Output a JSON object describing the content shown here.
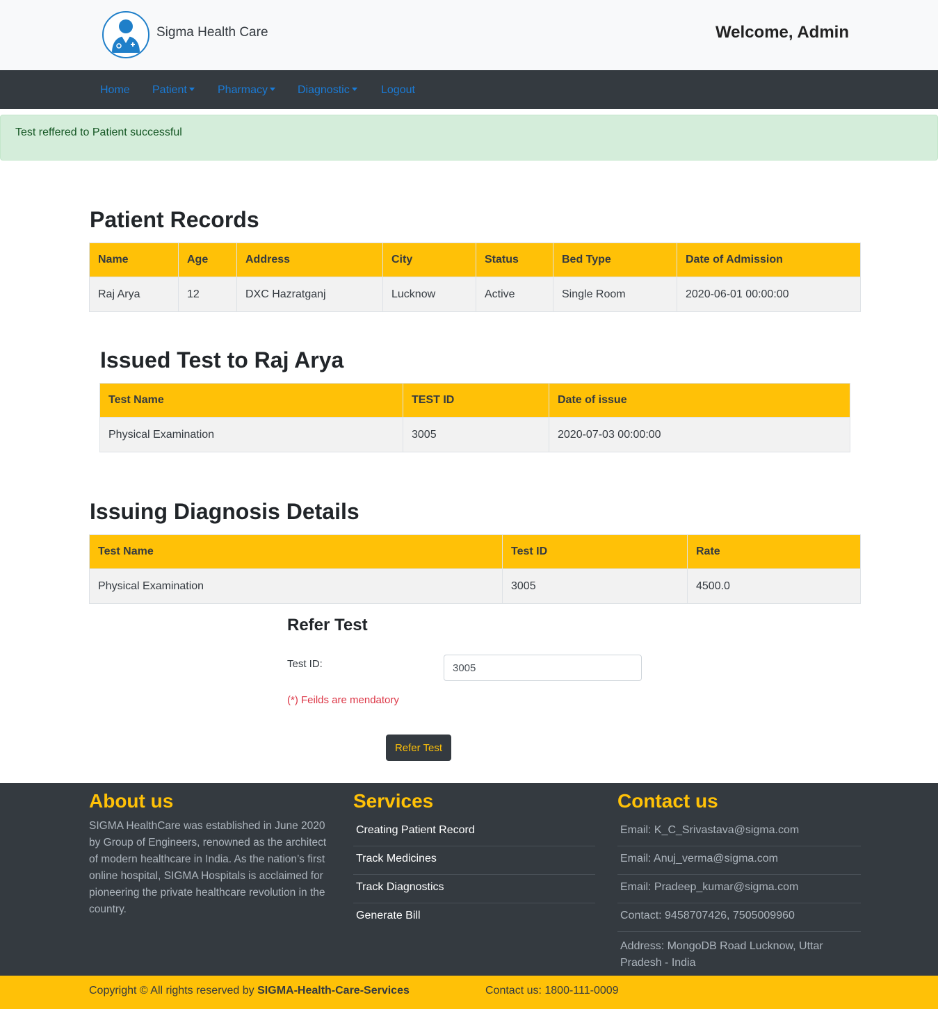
{
  "header": {
    "brand": "Sigma Health Care",
    "welcome": "Welcome, Admin"
  },
  "nav": {
    "home": "Home",
    "patient": "Patient",
    "pharmacy": "Pharmacy",
    "diagnostic": "Diagnostic",
    "logout": "Logout"
  },
  "alert": "Test reffered to Patient successful",
  "patient_records": {
    "title": "Patient Records",
    "headers": [
      "Name",
      "Age",
      "Address",
      "City",
      "Status",
      "Bed Type",
      "Date of Admission"
    ],
    "row": [
      "Raj Arya",
      "12",
      "DXC Hazratganj",
      "Lucknow",
      "Active",
      "Single Room",
      "2020-06-01 00:00:00"
    ]
  },
  "issued_tests": {
    "title": "Issued Test to Raj Arya",
    "headers": [
      "Test Name",
      "TEST ID",
      "Date of issue"
    ],
    "row": [
      "Physical Examination",
      "3005",
      "2020-07-03 00:00:00"
    ]
  },
  "diagnosis_details": {
    "title": "Issuing Diagnosis Details",
    "headers": [
      "Test Name",
      "Test ID",
      "Rate"
    ],
    "row": [
      "Physical Examination",
      "3005",
      "4500.0"
    ]
  },
  "refer_form": {
    "title": "Refer Test",
    "test_id_label": "Test ID:",
    "test_id_value": "3005",
    "mandatory_note": "(*) Feilds are mendatory",
    "submit_label": "Refer Test"
  },
  "footer": {
    "about_title": "About us",
    "about_text": "SIGMA HealthCare was established in June 2020 by Group of Engineers, renowned as the architect of modern healthcare in India. As the nation’s first online hospital, SIGMA Hospitals is acclaimed for pioneering the private healthcare revolution in the country.",
    "services_title": "Services",
    "services": [
      "Creating Patient Record",
      "Track Medicines",
      "Track Diagnostics",
      "Generate Bill"
    ],
    "contact_title": "Contact us",
    "contacts": [
      "Email: K_C_Srivastava@sigma.com",
      "Email: Anuj_verma@sigma.com",
      "Email: Pradeep_kumar@sigma.com",
      "Contact: 9458707426, 7505009960",
      "Address: MongoDB Road Lucknow, Uttar Pradesh - India"
    ]
  },
  "bottom_bar": {
    "copyright_prefix": "Copyright © All rights reserved by",
    "copyright_org": "SIGMA-Health-Care-Services",
    "contact": "Contact us: 1800-111-0009"
  },
  "colors": {
    "accent": "#ffc107",
    "dark": "#343a40",
    "link": "#1a7bd6",
    "success_bg": "#d4edda",
    "danger": "#dc3545"
  }
}
